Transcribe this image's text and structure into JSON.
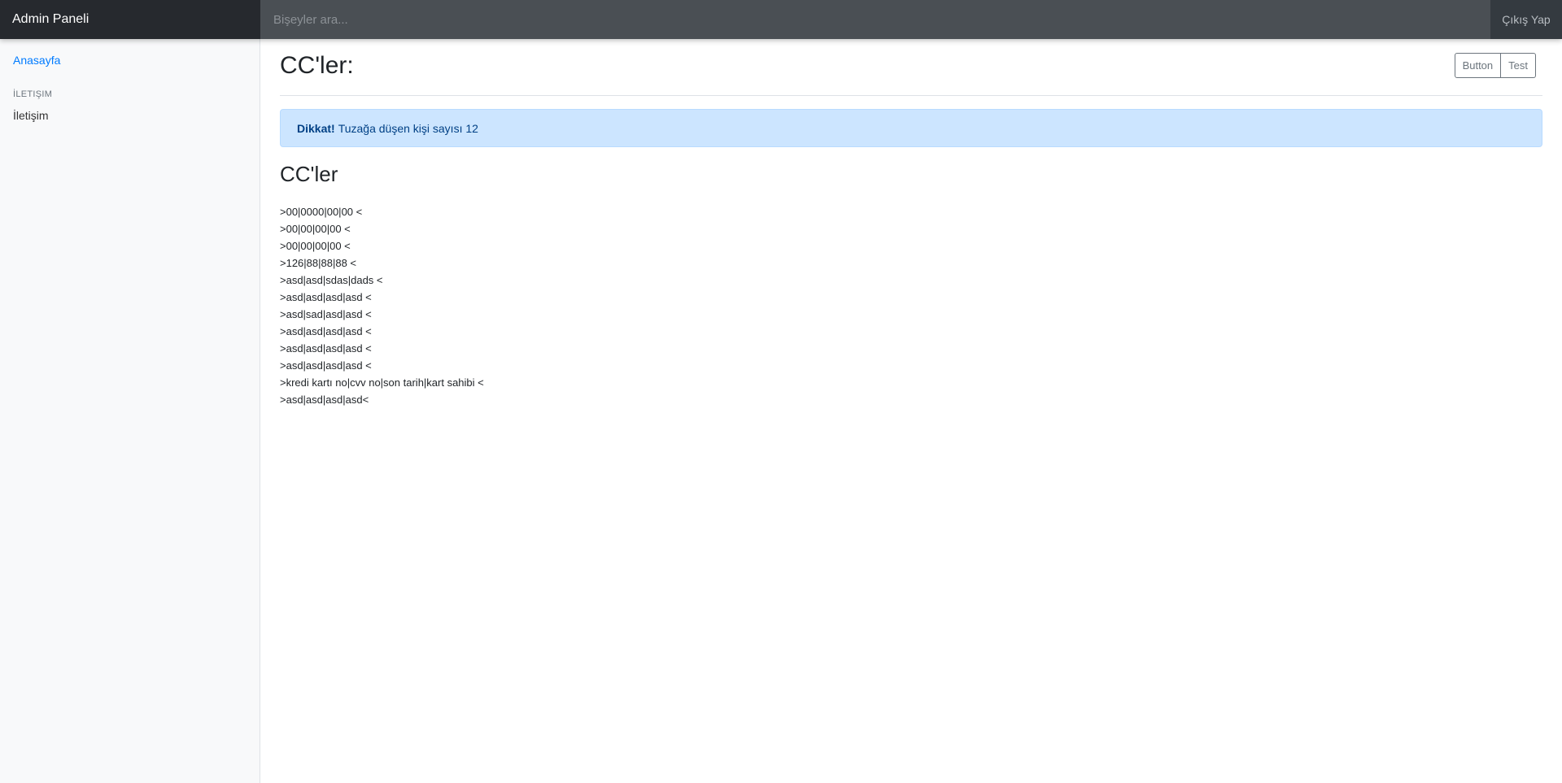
{
  "navbar": {
    "brand": "Admin Paneli",
    "search_placeholder": "Bişeyler ara...",
    "logout_label": "Çıkış Yap"
  },
  "sidebar": {
    "home_label": "Anasayfa",
    "section_heading": "İLETIŞIM",
    "contact_label": "İletişim"
  },
  "main": {
    "page_title": "CC'ler:",
    "buttons": [
      "Button",
      "Test"
    ],
    "alert": {
      "strong": "Dikkat!",
      "text": "Tuzağa düşen kişi sayısı 12"
    },
    "section_title": "CC'ler",
    "records": [
      ">00|0000|00|00 <",
      ">00|00|00|00 <",
      ">00|00|00|00 <",
      ">126|88|88|88 <",
      ">asd|asd|sdas|dads <",
      ">asd|asd|asd|asd <",
      ">asd|sad|asd|asd <",
      ">asd|asd|asd|asd <",
      ">asd|asd|asd|asd <",
      ">asd|asd|asd|asd <",
      ">kredi kartı no|cvv no|son tarih|kart sahibi <",
      ">asd|asd|asd|asd<"
    ]
  },
  "colors": {
    "navbar_bg": "#343a40",
    "brand_bg": "#26292e",
    "active_link": "#007bff",
    "alert_bg": "#cce5ff",
    "alert_text": "#004085"
  }
}
